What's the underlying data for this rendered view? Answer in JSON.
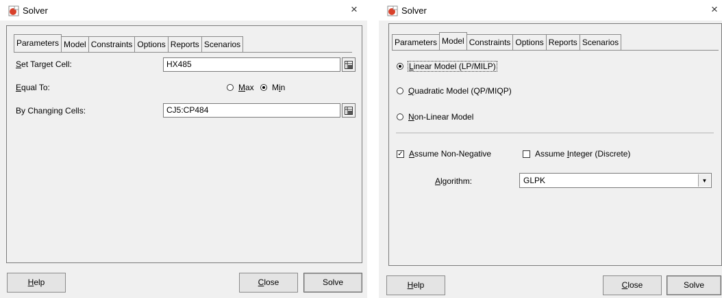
{
  "left_dialog": {
    "title": "Solver",
    "close_glyph": "×",
    "tabs": [
      "Parameters",
      "Model",
      "Constraints",
      "Options",
      "Reports",
      "Scenarios"
    ],
    "active_tab": "Parameters",
    "set_target_cell": {
      "label_u": "S",
      "label_rest": "et Target Cell:",
      "value": "HX485"
    },
    "equal_to": {
      "label_u": "E",
      "label_rest": "qual To:",
      "max_u": "M",
      "max_rest": "ax",
      "min_pre": "M",
      "min_u": "i",
      "min_rest": "n",
      "selected": "Min"
    },
    "by_changing": {
      "label": "By Changing Cells:",
      "value": "CJ5:CP484"
    },
    "buttons": {
      "help_u": "H",
      "help_rest": "elp",
      "close_u": "C",
      "close_rest": "lose",
      "solve": "Solve"
    }
  },
  "right_dialog": {
    "title": "Solver",
    "close_glyph": "×",
    "tabs": [
      "Parameters",
      "Model",
      "Constraints",
      "Options",
      "Reports",
      "Scenarios"
    ],
    "active_tab": "Model",
    "models": [
      {
        "u": "L",
        "rest": "inear Model (LP/MILP)",
        "selected": true
      },
      {
        "u": "Q",
        "rest": "uadratic Model (QP/MIQP)",
        "selected": false
      },
      {
        "u": "N",
        "rest": "on-Linear Model",
        "selected": false
      }
    ],
    "assume_non_negative": {
      "u": "A",
      "rest": "ssume Non-Negative",
      "checked": true
    },
    "assume_integer": {
      "pre": "Assume ",
      "u": "I",
      "rest": "nteger (Discrete)",
      "checked": false
    },
    "algorithm": {
      "u": "A",
      "rest": "lgorithm:",
      "value": "GLPK"
    },
    "buttons": {
      "help_u": "H",
      "help_rest": "elp",
      "close_u": "C",
      "close_rest": "lose",
      "solve": "Solve"
    }
  },
  "colors": {
    "window_bg": "#f0f0f0",
    "icon_red": "#d9412b"
  }
}
